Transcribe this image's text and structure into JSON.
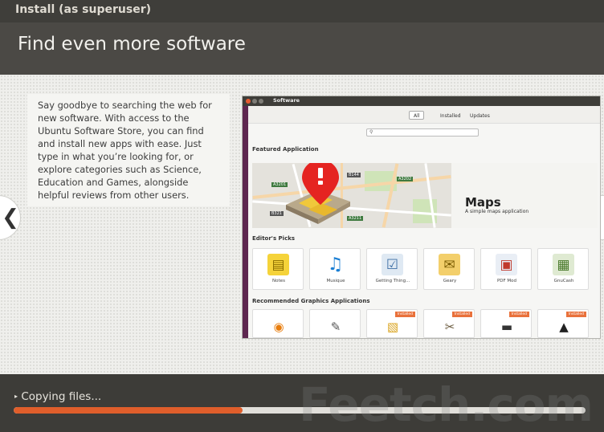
{
  "window": {
    "title": "Install (as superuser)"
  },
  "header": {
    "title": "Find even more software"
  },
  "slide": {
    "description": "Say goodbye to searching the web for new software. With access to the Ubuntu Software Store, you can find and install new apps with ease. Just type in what you’re looking for, or explore categories such as Science, Education and Games, alongside helpful reviews from other users.",
    "prev_icon": "chevron-left-icon",
    "next_icon": "chevron-right-icon",
    "prev_glyph": "❮",
    "next_glyph": "❯"
  },
  "software_screenshot": {
    "title": "Software",
    "tabs": [
      {
        "label": "All",
        "active": true
      },
      {
        "label": "Installed",
        "active": false
      },
      {
        "label": "Updates",
        "active": false
      }
    ],
    "search_placeholder": "",
    "featured_heading": "Featured Application",
    "featured": {
      "name": "Maps",
      "tagline": "A simple maps application"
    },
    "map_labels": [
      "A3201",
      "B144",
      "A3202",
      "B321",
      "A3211",
      "A3211"
    ],
    "editors_heading": "Editor's Picks",
    "editors_picks": [
      {
        "label": "Notes",
        "icon": "notes-icon",
        "glyph": "▤",
        "color": "#f5d33a"
      },
      {
        "label": "Musique",
        "icon": "music-icon",
        "glyph": "♫",
        "color": "#ffffff"
      },
      {
        "label": "Getting Thing...",
        "icon": "checklist-icon",
        "glyph": "☑",
        "color": "#dfe9f3"
      },
      {
        "label": "Geary",
        "icon": "mail-icon",
        "glyph": "✉",
        "color": "#f3cf6b"
      },
      {
        "label": "PDF Mod",
        "icon": "pdf-icon",
        "glyph": "▣",
        "color": "#e9eef5"
      },
      {
        "label": "GnuCash",
        "icon": "finance-icon",
        "glyph": "▦",
        "color": "#dfead2"
      }
    ],
    "recommended_heading": "Recommended Graphics Applications",
    "recommended": [
      {
        "icon": "blender-icon",
        "glyph": "◉",
        "badge": ""
      },
      {
        "icon": "paint-icon",
        "glyph": "✎",
        "badge": ""
      },
      {
        "icon": "image-viewer-icon",
        "glyph": "▧",
        "badge": "Installed"
      },
      {
        "icon": "gimp-icon",
        "glyph": "✂",
        "badge": "Installed"
      },
      {
        "icon": "scanner-icon",
        "glyph": "▬",
        "badge": "Installed"
      },
      {
        "icon": "inkscape-icon",
        "glyph": "▲",
        "badge": "Installed"
      }
    ],
    "installed_badge": "Installed"
  },
  "progress": {
    "label": "Copying files...",
    "value_percent": 40
  },
  "watermark": {
    "text": "Feetch.com"
  },
  "colors": {
    "accent": "#e05e2b",
    "launcher": "#5e2750",
    "background": "#3c3b37"
  }
}
